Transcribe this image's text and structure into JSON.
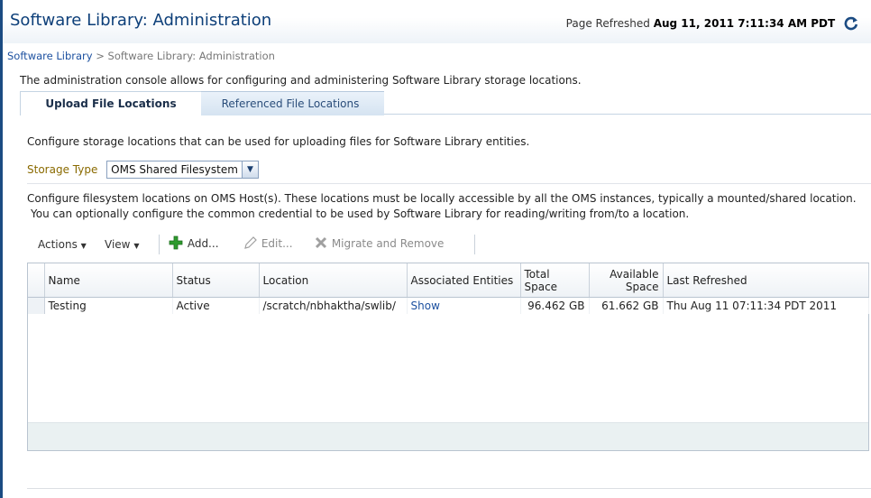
{
  "header": {
    "title": "Software Library: Administration",
    "refreshed_label": "Page Refreshed",
    "refreshed_time": "Aug 11, 2011 7:11:34 AM PDT"
  },
  "breadcrumb": {
    "root": "Software Library",
    "separator": ">",
    "current": "Software Library: Administration"
  },
  "description": "The administration console allows for configuring and administering Software Library storage locations.",
  "tabs": [
    {
      "label": "Upload File Locations"
    },
    {
      "label": "Referenced File Locations"
    }
  ],
  "upload": {
    "intro": "Configure storage locations that can be used for uploading files for Software Library entities.",
    "storage_type_label": "Storage Type",
    "storage_type_value": "OMS Shared Filesystem",
    "help_line1": "Configure filesystem locations on OMS Host(s). These locations must be locally accessible by all the OMS instances, typically a mounted/shared location.",
    "help_line2": "You can optionally configure the common credential to be used by Software Library for  reading/writing from/to a location."
  },
  "toolbar": {
    "actions": "Actions",
    "view": "View",
    "add": "Add...",
    "edit": "Edit...",
    "migrate": "Migrate and Remove"
  },
  "table": {
    "headers": [
      "Name",
      "Status",
      "Location",
      "Associated Entities",
      "Total Space",
      "Available Space",
      "Last Refreshed"
    ],
    "rows": [
      [
        "Testing",
        "Active",
        "/scratch/nbhaktha/swlib/",
        "Show",
        "96.462 GB",
        "61.662 GB",
        "Thu Aug 11 07:11:34 PDT 2011"
      ]
    ]
  },
  "colors": {
    "title": "#0d3f79",
    "link": "#1d51a0",
    "storage_label": "#8a6a00",
    "add_icon": "#2e9b2e"
  }
}
